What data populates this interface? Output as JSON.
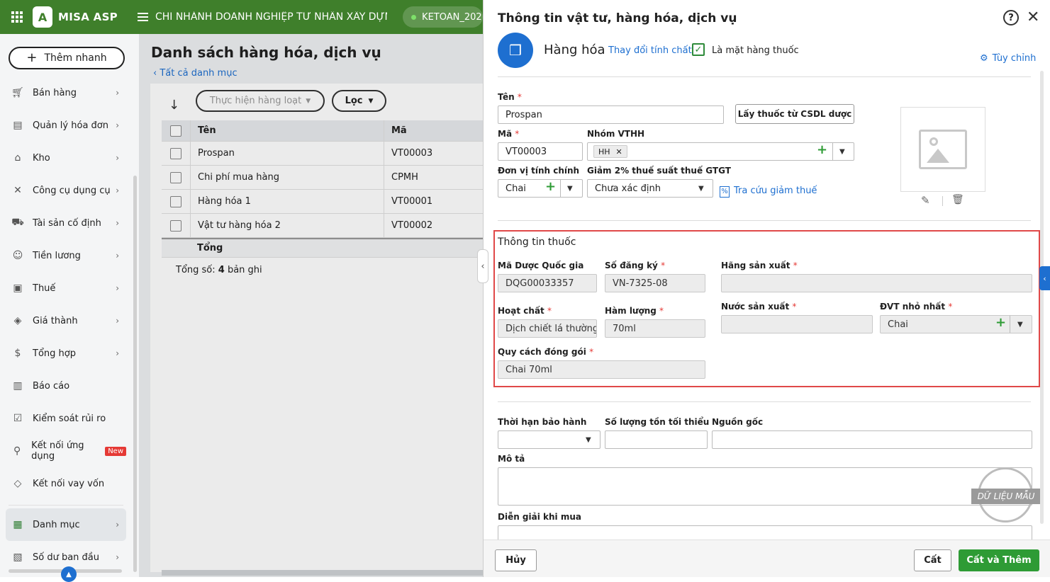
{
  "topbar": {
    "app_name": "MISA ASP",
    "company": "CHI NHÁNH DOANH NGHIỆP TƯ NHÂN XÂY DỰNG ...",
    "database": "KETOAN_202"
  },
  "sidebar": {
    "quick_add": "Thêm nhanh",
    "items": [
      {
        "label": "Bán hàng",
        "icon": "cart-icon"
      },
      {
        "label": "Quản lý hóa đơn",
        "icon": "invoice-icon"
      },
      {
        "label": "Kho",
        "icon": "warehouse-icon"
      },
      {
        "label": "Công cụ dụng cụ",
        "icon": "tools-icon"
      },
      {
        "label": "Tài sản cố định",
        "icon": "car-icon"
      },
      {
        "label": "Tiền lương",
        "icon": "salary-icon"
      },
      {
        "label": "Thuế",
        "icon": "tax-icon"
      },
      {
        "label": "Giá thành",
        "icon": "price-tag-icon"
      },
      {
        "label": "Tổng hợp",
        "icon": "summary-icon"
      },
      {
        "label": "Báo cáo",
        "icon": "report-icon"
      },
      {
        "label": "Kiểm soát rủi ro",
        "icon": "risk-icon"
      },
      {
        "label": "Kết nối ứng dụng",
        "icon": "plug-icon",
        "badge": "New"
      },
      {
        "label": "Kết nối vay vốn",
        "icon": "loan-icon"
      },
      {
        "label": "Danh mục",
        "icon": "catalog-icon"
      },
      {
        "label": "Số dư ban đầu",
        "icon": "balance-icon"
      }
    ]
  },
  "main": {
    "title": "Danh sách hàng hóa, dịch vụ",
    "breadcrumb": "Tất cả danh mục",
    "bulk_action": "Thực hiện hàng loạt",
    "filter": "Lọc",
    "columns": [
      "Tên",
      "Mã"
    ],
    "rows": [
      {
        "name": "Prospan",
        "code": "VT00003"
      },
      {
        "name": "Chi phí mua hàng",
        "code": "CPMH"
      },
      {
        "name": "Hàng hóa 1",
        "code": "VT00001"
      },
      {
        "name": "Vật tư hàng hóa 2",
        "code": "VT00002"
      }
    ],
    "total_label": "Tổng",
    "count_prefix": "Tổng số: ",
    "count_value": "4",
    "count_suffix": " bản ghi"
  },
  "panel": {
    "title": "Thông tin vật tư, hàng hóa, dịch vụ",
    "type_name": "Hàng hóa",
    "change_type": "Thay đổi tính chất",
    "is_drug_label": "Là mặt hàng thuốc",
    "customize": "Tùy chỉnh",
    "name_label": "Tên",
    "name_value": "Prospan",
    "fetch_btn": "Lấy thuốc từ CSDL dược",
    "code_label": "Mã",
    "code_value": "VT00003",
    "group_label": "Nhóm VTHH",
    "group_tag": "HH",
    "unit_label": "Đơn vị tính chính",
    "unit_value": "Chai",
    "vat_label": "Giảm 2% thuế suất thuế GTGT",
    "vat_value": "Chưa xác định",
    "lookup": "Tra cứu giảm thuế",
    "drug_section": {
      "title": "Thông tin thuốc",
      "national_code_label": "Mã Dược Quốc gia",
      "national_code": "DQG00033357",
      "reg_no_label": "Số đăng ký",
      "reg_no": "VN-7325-08",
      "manufacturer_label": "Hãng sản xuất",
      "manufacturer": "",
      "ingredient_label": "Hoạt chất",
      "ingredient": "Dịch chiết lá thường xuân",
      "content_label": "Hàm lượng",
      "content": "70ml",
      "country_label": "Nước sản xuất",
      "country": "",
      "min_unit_label": "ĐVT nhỏ nhất",
      "min_unit": "Chai",
      "packing_label": "Quy cách đóng gói",
      "packing": "Chai 70ml"
    },
    "warranty_label": "Thời hạn bảo hành",
    "min_stock_label": "Số lượng tồn tối thiểu",
    "origin_label": "Nguồn gốc",
    "desc_label": "Mô tả",
    "purchase_desc_label": "Diễn giải khi mua",
    "sample_stamp": "DỮ LIỆU MẪU",
    "cancel": "Hủy",
    "save": "Cất",
    "save_add": "Cất và Thêm"
  }
}
